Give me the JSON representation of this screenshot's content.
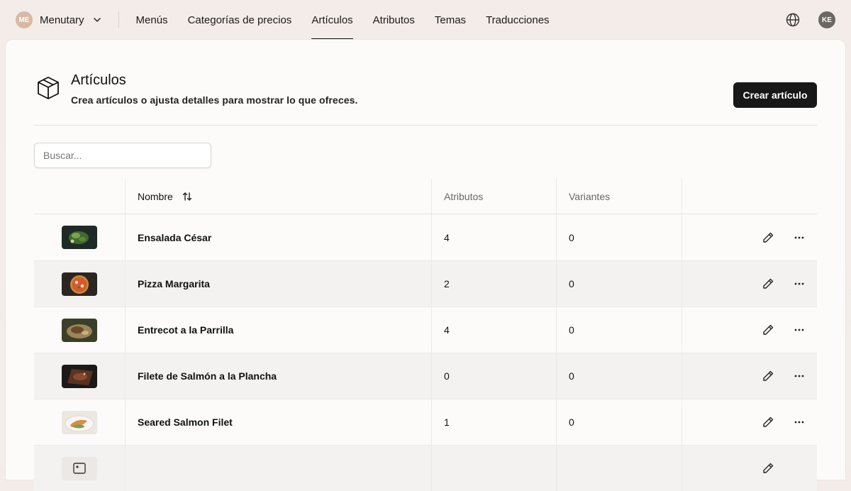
{
  "nav": {
    "org_initials": "ME",
    "org_name": "Menutary",
    "links": [
      "Menús",
      "Categorías de precios",
      "Artículos",
      "Atributos",
      "Temas",
      "Traducciones"
    ],
    "active_link": "Artículos",
    "user_initials": "KE"
  },
  "header": {
    "icon": "package-icon",
    "title": "Artículos",
    "subtitle": "Crea artículos o ajusta detalles para mostrar lo que ofreces.",
    "create_button": "Crear artículo"
  },
  "search": {
    "placeholder": "Buscar..."
  },
  "table": {
    "columns": {
      "name": "Nombre",
      "attributes": "Atributos",
      "variants": "Variantes"
    },
    "rows": [
      {
        "name": "Ensalada César",
        "attributes": "4",
        "variants": "0",
        "image": "salad-photo"
      },
      {
        "name": "Pizza Margarita",
        "attributes": "2",
        "variants": "0",
        "image": "pizza-photo"
      },
      {
        "name": "Entrecot a la Parrilla",
        "attributes": "4",
        "variants": "0",
        "image": "steak-photo"
      },
      {
        "name": "Filete de Salmón a la Plancha",
        "attributes": "0",
        "variants": "0",
        "image": "salmon-board-photo"
      },
      {
        "name": "Seared Salmon Filet",
        "attributes": "1",
        "variants": "0",
        "image": "salmon-plate-photo"
      }
    ]
  },
  "colors": {
    "primary_button": "#181818",
    "accent_underline": "#111111",
    "background": "#f4ece8"
  }
}
